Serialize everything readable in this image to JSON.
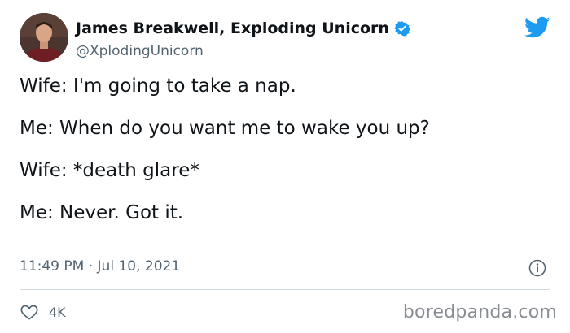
{
  "tweet": {
    "author": {
      "display_name": "James Breakwell, Exploding Unicorn",
      "handle": "@XplodingUnicorn",
      "verified": true,
      "avatar": "profile-photo"
    },
    "lines": [
      "Wife: I'm going to take a nap.",
      "Me: When do you want me to wake you up?",
      "Wife: *death glare*",
      "Me: Never. Got it."
    ],
    "timestamp": "11:49 PM · Jul 10, 2021",
    "likes": "4K"
  },
  "icons": {
    "brand": "twitter-bird-icon",
    "verified": "verified-badge-icon",
    "info": "info-icon",
    "like": "heart-icon"
  },
  "colors": {
    "twitter_blue": "#1d9bf0",
    "text": "#0f1419",
    "secondary_text": "#536471",
    "divider": "#cfd9de",
    "watermark": "#888d93"
  },
  "watermark": {
    "text": "boredpanda.com"
  }
}
